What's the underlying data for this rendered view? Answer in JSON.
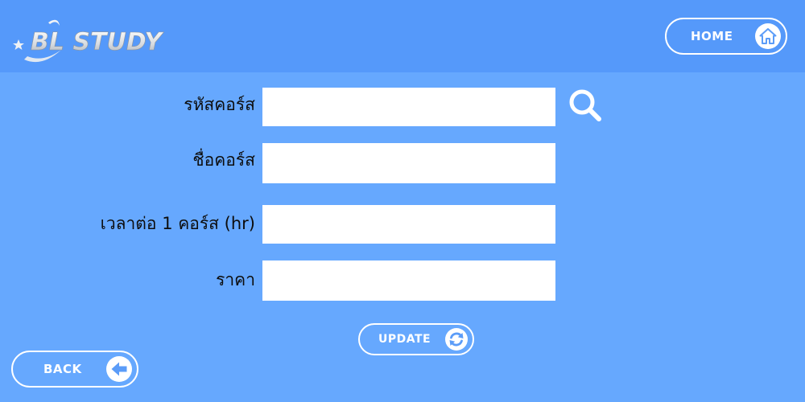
{
  "header": {
    "logo_text": "BL STUDY",
    "home_label": "HOME"
  },
  "form": {
    "fields": [
      {
        "label": "รหัสคอร์ส",
        "value": ""
      },
      {
        "label": "ชื่อคอร์ส",
        "value": ""
      },
      {
        "label": "เวลาต่อ 1 คอร์ส (hr)",
        "value": ""
      },
      {
        "label": "ราคา",
        "value": ""
      }
    ]
  },
  "actions": {
    "update_label": "UPDATE",
    "back_label": "BACK"
  },
  "icons": {
    "logo": "star-moon-logo-icon",
    "home": "home-icon",
    "search": "search-icon",
    "update": "refresh-icon",
    "back": "arrow-left-icon"
  },
  "colors": {
    "background": "#66a8fe",
    "header": "#5599fa",
    "icon_blue": "#5b9cf8",
    "white": "#ffffff"
  }
}
